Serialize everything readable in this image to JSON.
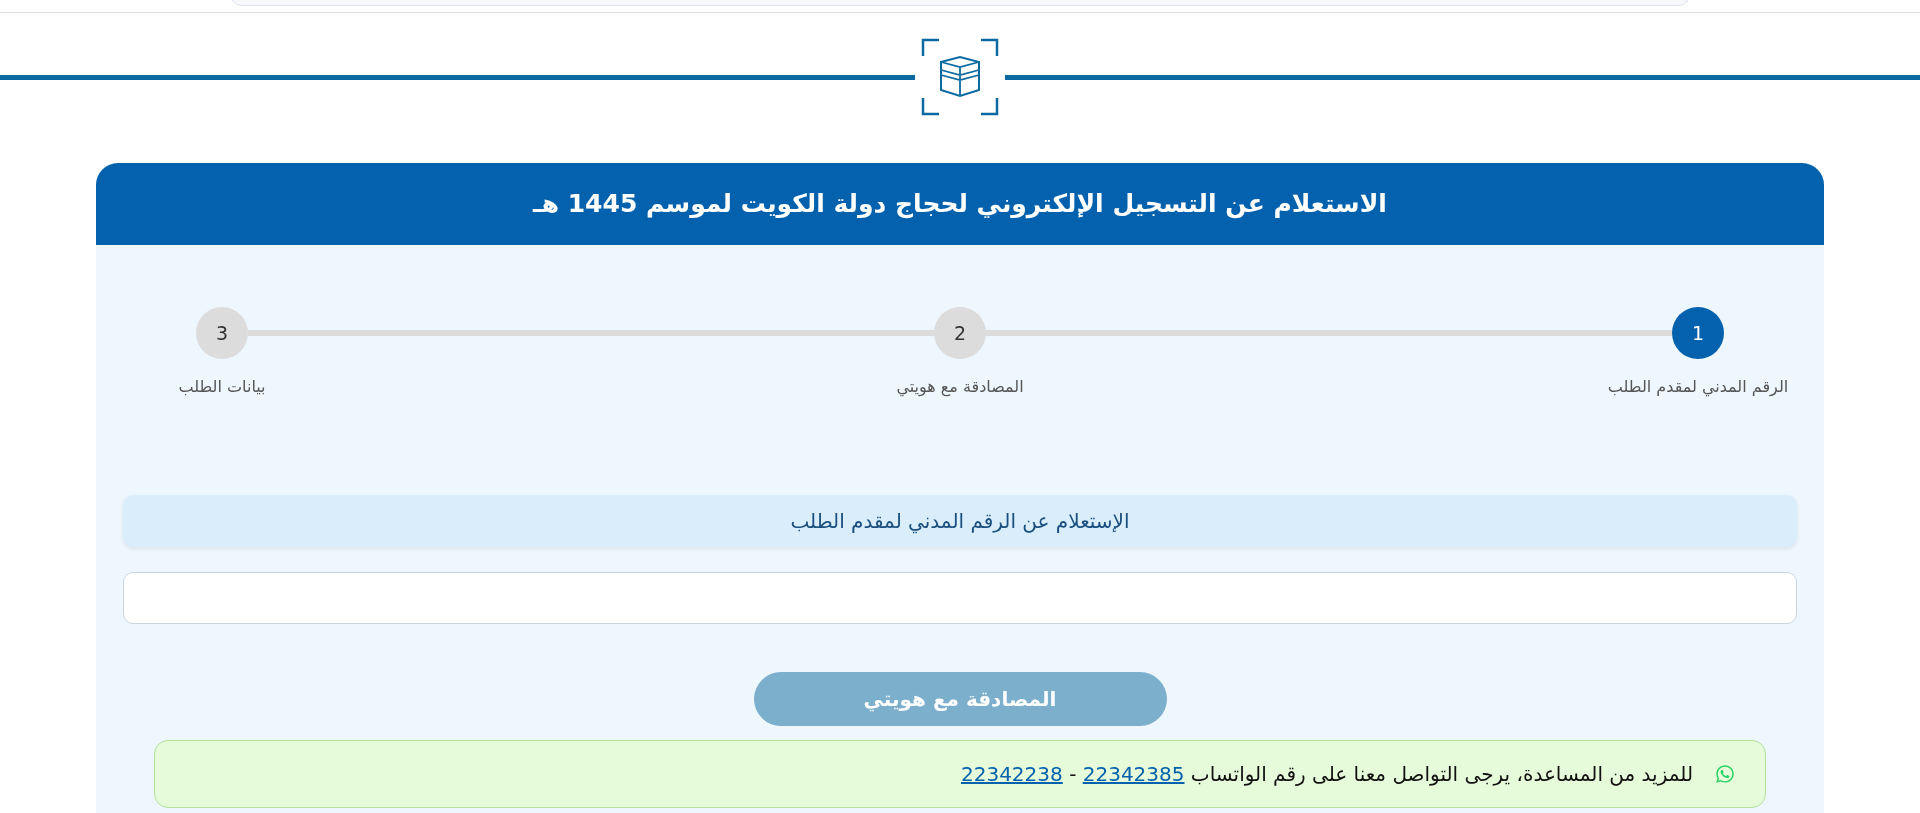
{
  "header": {
    "title": "الاستعلام عن التسجيل الإلكتروني لحجاج دولة الكويت لموسم 1445 هـ"
  },
  "steps": [
    {
      "number": "1",
      "label": "الرقم المدني لمقدم الطلب",
      "selected": true
    },
    {
      "number": "2",
      "label": "المصادقة مع هويتي",
      "selected": false
    },
    {
      "number": "3",
      "label": "بيانات الطلب",
      "selected": false
    }
  ],
  "section_title": "الإستعلام عن الرقم المدني لمقدم الطلب",
  "button": {
    "label": "المصادقة مع هويتي",
    "disabled": true
  },
  "help": {
    "text": "للمزيد من المساعدة، يرجى التواصل معنا على رقم الواتساب",
    "phones": [
      "22342385",
      "22342238"
    ],
    "separator": "-"
  }
}
